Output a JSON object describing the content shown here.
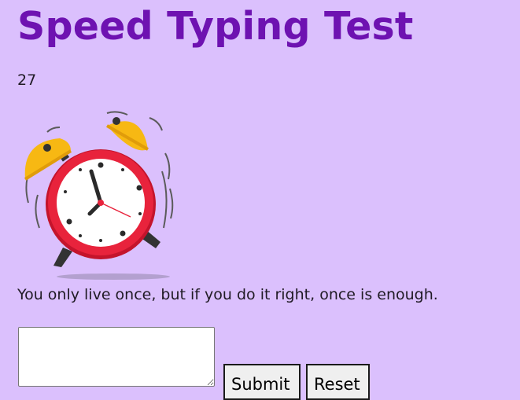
{
  "page": {
    "title": "Speed Typing Test",
    "timer_value": "27",
    "quote": "You only live once, but if you do it right, once is enough.",
    "image": "alarm-clock-icon"
  },
  "input": {
    "value": "",
    "placeholder": ""
  },
  "buttons": {
    "submit_label": "Submit",
    "reset_label": "Reset"
  },
  "colors": {
    "background": "#dbc0fd",
    "title": "#6e12b1",
    "clock_body": "#e31b35",
    "clock_bells": "#f7b813"
  }
}
